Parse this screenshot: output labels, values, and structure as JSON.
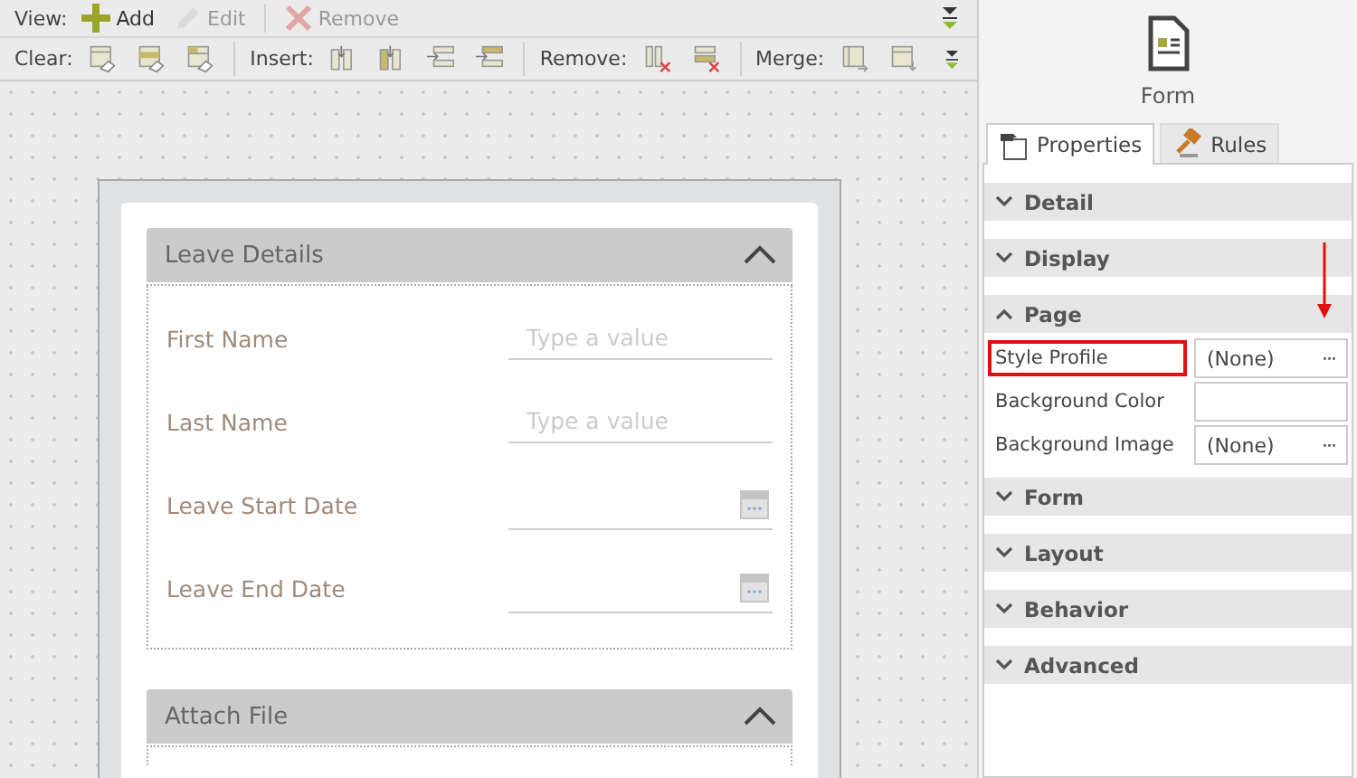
{
  "view_toolbar": {
    "label": "View:",
    "buttons": [
      {
        "kind": "add",
        "label": "Add",
        "disabled": false
      },
      {
        "kind": "edit",
        "label": "Edit",
        "disabled": true
      },
      {
        "kind": "remove",
        "label": "Remove",
        "disabled": true
      }
    ]
  },
  "table_toolbar": {
    "groups": [
      {
        "label": "Clear:",
        "buttons": [
          {
            "kind": "clear-table"
          },
          {
            "kind": "clear-row"
          },
          {
            "kind": "clear-cell"
          }
        ]
      },
      {
        "label": "Insert:",
        "buttons": [
          {
            "kind": "insert-col-left"
          },
          {
            "kind": "insert-col-right"
          },
          {
            "kind": "insert-row-above"
          },
          {
            "kind": "insert-row-below"
          }
        ]
      },
      {
        "label": "Remove:",
        "buttons": [
          {
            "kind": "remove-col"
          },
          {
            "kind": "remove-row"
          }
        ]
      },
      {
        "label": "Merge:",
        "buttons": [
          {
            "kind": "merge-right"
          },
          {
            "kind": "merge-down"
          }
        ]
      }
    ]
  },
  "form": {
    "sections": [
      {
        "title": "Leave Details",
        "expanded": true,
        "fields": [
          {
            "kind": "text",
            "label": "First Name",
            "placeholder": "Type a value"
          },
          {
            "kind": "text",
            "label": "Last Name",
            "placeholder": "Type a value"
          },
          {
            "kind": "date",
            "label": "Leave Start Date"
          },
          {
            "kind": "date",
            "label": "Leave End Date"
          }
        ]
      },
      {
        "title": "Attach File",
        "expanded": true
      }
    ]
  },
  "properties_panel": {
    "object_title": "Form",
    "tabs": [
      {
        "label": "Properties",
        "kind": "properties",
        "selected": true
      },
      {
        "label": "Rules",
        "kind": "rules",
        "selected": false
      }
    ],
    "categories": [
      {
        "title": "Detail",
        "expanded": false
      },
      {
        "title": "Display",
        "expanded": false
      },
      {
        "title": "Page",
        "expanded": true,
        "properties": [
          {
            "name": "Style Profile",
            "value": "(None)",
            "browse": "···",
            "highlighted": true,
            "arrow": true
          },
          {
            "name": "Background Color",
            "highlighted": false
          },
          {
            "name": "Background Image",
            "value": "(None)",
            "browse": "···",
            "highlighted": false
          }
        ]
      },
      {
        "title": "Form",
        "expanded": false
      },
      {
        "title": "Layout",
        "expanded": false
      },
      {
        "title": "Behavior",
        "expanded": false
      },
      {
        "title": "Advanced",
        "expanded": false
      }
    ]
  }
}
